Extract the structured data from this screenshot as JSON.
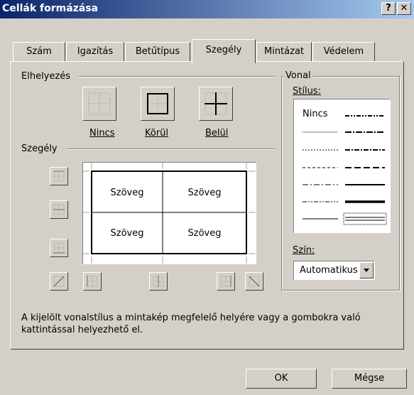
{
  "window": {
    "title": "Cellák formázása",
    "help_label": "?",
    "close_label": "✕"
  },
  "tabs": [
    {
      "label": "Szám"
    },
    {
      "label": "Igazítás"
    },
    {
      "label": "Betűtípus"
    },
    {
      "label": "Szegély",
      "active": true
    },
    {
      "label": "Mintázat"
    },
    {
      "label": "Védelem"
    }
  ],
  "placement": {
    "group_label": "Elhelyezés",
    "presets": [
      {
        "label": "Nincs",
        "icon": "no-border-icon"
      },
      {
        "label": "Körül",
        "icon": "outline-border-icon"
      },
      {
        "label": "Belül",
        "icon": "inside-border-icon"
      }
    ]
  },
  "border": {
    "group_label": "Szegély",
    "preview_cells": [
      "Szöveg",
      "Szöveg",
      "Szöveg",
      "Szöveg"
    ]
  },
  "line": {
    "group_label": "Vonal",
    "style_label": "Stílus:",
    "none_label": "Nincs",
    "color_label": "Szín:",
    "color_value": "Automatikus"
  },
  "hint_line1": "A kijelölt vonalstílus a mintakép megfelelő helyére vagy a gombokra való",
  "hint_line2": "kattintással helyezhető el.",
  "buttons": {
    "ok": "OK",
    "cancel": "Mégse"
  },
  "colors": {
    "titlebar_start": "#0a246a",
    "titlebar_end": "#a6caf0",
    "face": "#d4d0c8"
  }
}
